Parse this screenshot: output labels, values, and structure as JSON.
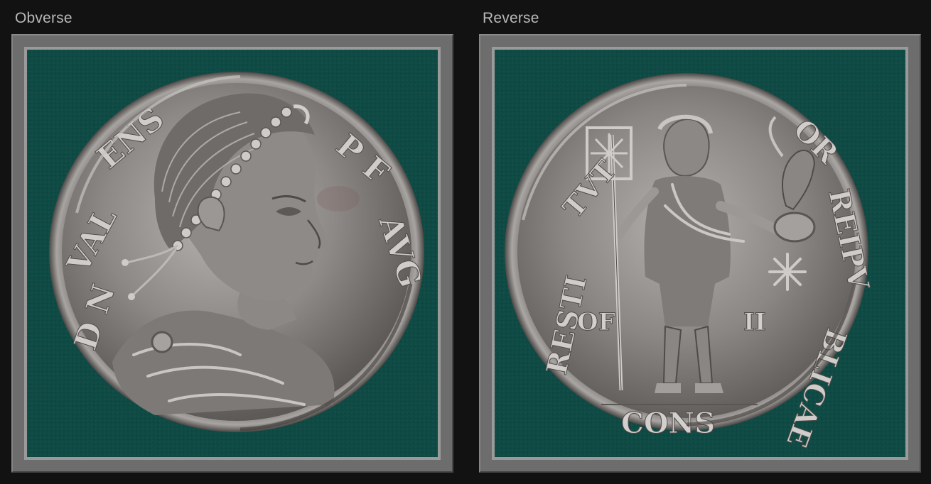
{
  "viewer": {
    "panels": [
      {
        "label": "Obverse",
        "image": "coin-obverse-photo",
        "legend": "D N VALENS P F AVG"
      },
      {
        "label": "Reverse",
        "image": "coin-reverse-photo",
        "legend": "RESTITVTOR REIPVBLICAE",
        "field_left": "OF",
        "field_right": "II",
        "exergue": "CONS"
      }
    ]
  },
  "colors": {
    "background": "#121212",
    "frame": "#6d6d6d",
    "felt": "#0f4a44",
    "silver": "#9d9a98",
    "label": "#b9b9b9"
  }
}
